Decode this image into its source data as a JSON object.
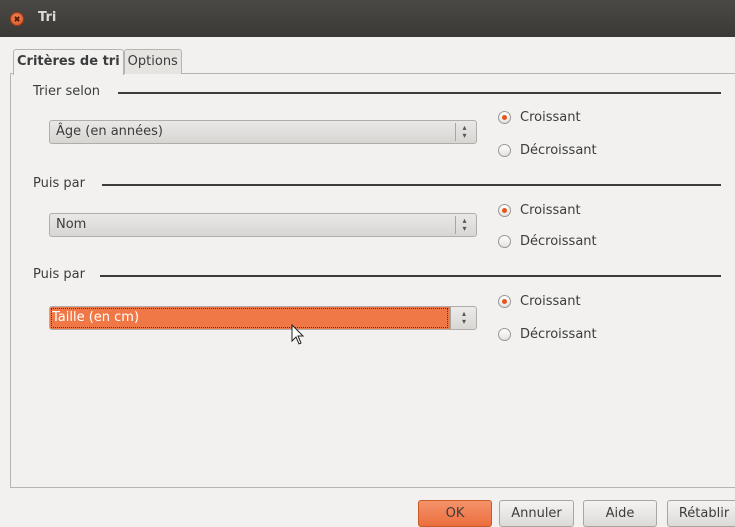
{
  "window": {
    "title": "Tri"
  },
  "tabs": [
    {
      "label": "Critères de tri"
    },
    {
      "label": "Options"
    }
  ],
  "groups": [
    {
      "label": "Trier selon",
      "value": "Âge (en années)",
      "ascending": "Croissant",
      "descending": "Décroissant",
      "selected": "ascending"
    },
    {
      "label": "Puis par",
      "value": "Nom",
      "ascending": "Croissant",
      "descending": "Décroissant",
      "selected": "ascending"
    },
    {
      "label": "Puis par",
      "value": "Taille (en cm)",
      "ascending": "Croissant",
      "descending": "Décroissant",
      "selected": "ascending"
    }
  ],
  "buttons": {
    "ok": "OK",
    "cancel": "Annuler",
    "help": "Aide",
    "reset": "Rétablir"
  },
  "colors": {
    "accent": "#f07846",
    "titlebar": "#3c3b37"
  }
}
